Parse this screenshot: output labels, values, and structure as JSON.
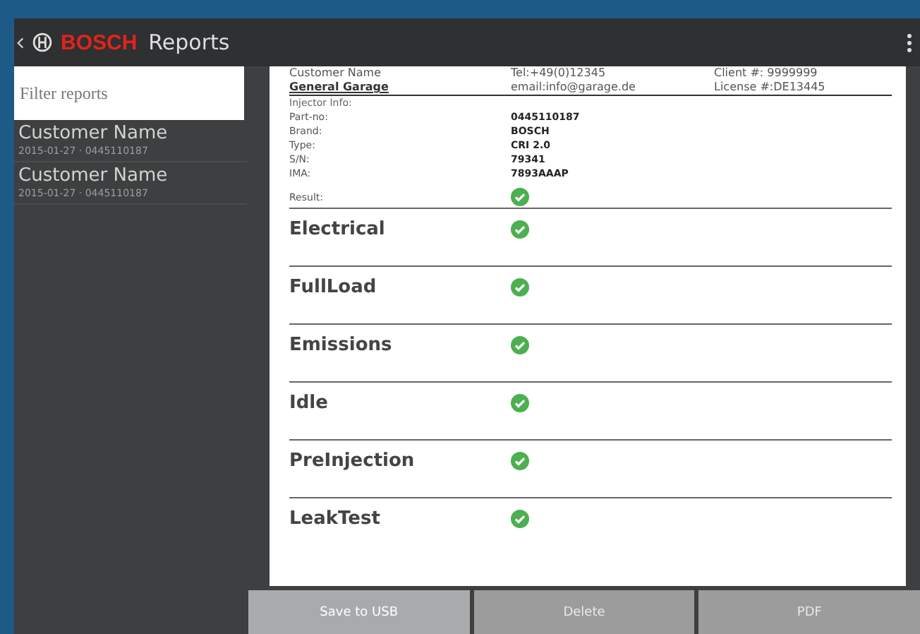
{
  "app_bar": {
    "title": "Reports",
    "brand": "BOSCH"
  },
  "sidebar": {
    "filter": {
      "placeholder": "Filter reports"
    },
    "items": [
      {
        "title": "Customer Name",
        "subtitle": "2015-01-27 · 0445110187",
        "selected": false
      },
      {
        "title": "Customer Name",
        "subtitle": "2015-01-27 · 0445110187",
        "selected": false
      }
    ]
  },
  "report": {
    "header_rows": [
      [
        "Customer Name",
        "Tel:+49(0)12345",
        "Client #: 9999999"
      ],
      [
        "General Garage",
        "email:info@garage.de",
        "License #:DE13445"
      ]
    ],
    "section_title": "Injector Info:",
    "fields": [
      {
        "label": "Part-no:",
        "value": "0445110187"
      },
      {
        "label": "Brand:",
        "value": "BOSCH"
      },
      {
        "label": "Type:",
        "value": "CRI 2.0"
      },
      {
        "label": "S/N:",
        "value": "79341"
      },
      {
        "label": "IMA:",
        "value": "7893AAAP"
      }
    ],
    "result": {
      "label": "Result:",
      "passed": true
    },
    "tests": [
      {
        "name": "Electrical",
        "passed": true
      },
      {
        "name": "FullLoad",
        "passed": true
      },
      {
        "name": "Emissions",
        "passed": true
      },
      {
        "name": "Idle",
        "passed": true
      },
      {
        "name": "PreInjection",
        "passed": true
      },
      {
        "name": "LeakTest",
        "passed": true
      }
    ]
  },
  "buttons": [
    {
      "label": "Save to USB",
      "disabled": true
    },
    {
      "label": "Delete",
      "disabled": false
    },
    {
      "label": "PDF",
      "disabled": false
    }
  ]
}
